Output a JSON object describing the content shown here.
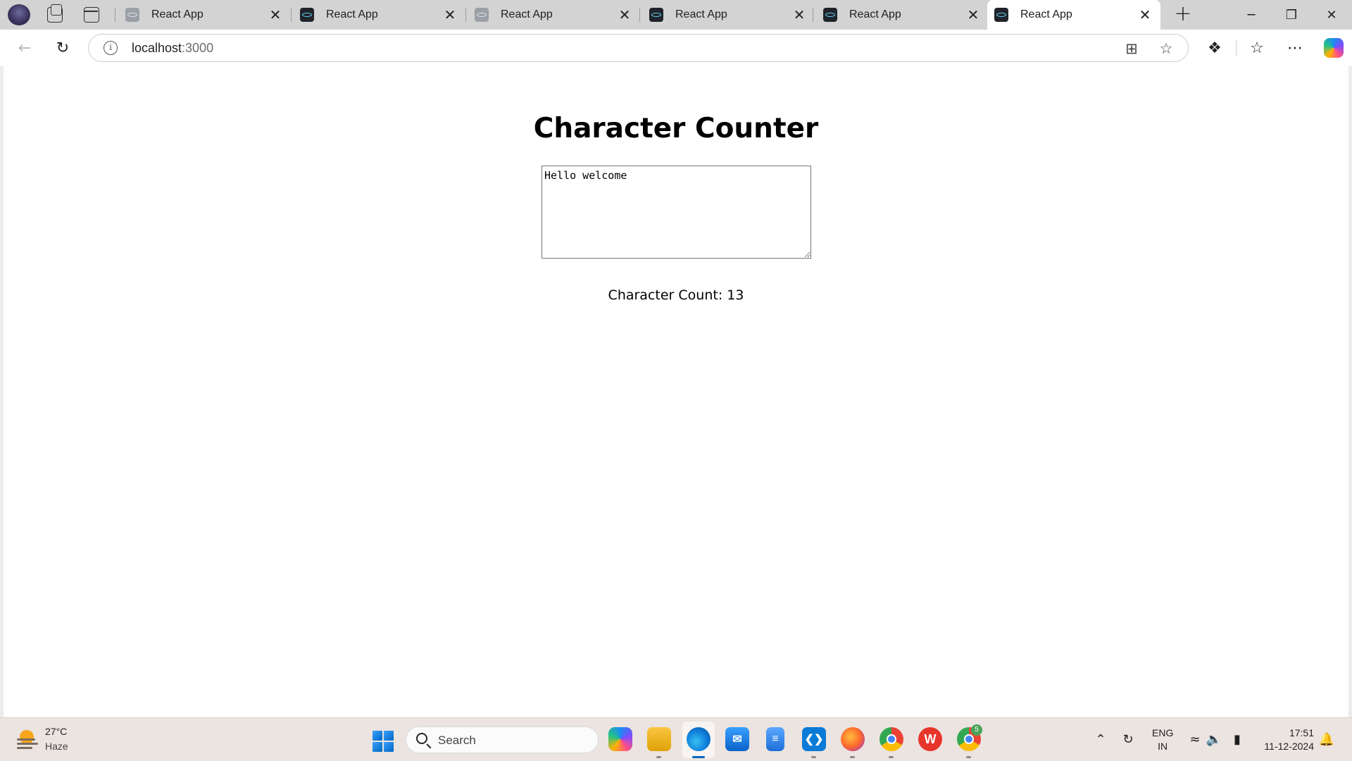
{
  "browser": {
    "tabs": [
      {
        "title": "React App",
        "close": "✕"
      },
      {
        "title": "React App",
        "close": "✕"
      },
      {
        "title": "React App",
        "close": "✕"
      },
      {
        "title": "React App",
        "close": "✕"
      },
      {
        "title": "React App",
        "close": "✕"
      },
      {
        "title": "React App",
        "close": "✕"
      }
    ],
    "active_tab_index": 5,
    "new_tab": "+",
    "window_controls": {
      "minimize": "─",
      "restore": "❐",
      "close": "✕"
    },
    "url_host": "localhost",
    "url_port": ":3000"
  },
  "page": {
    "title": "Character Counter",
    "textarea_value": "Hello welcome",
    "count_label": "Character Count: 13"
  },
  "taskbar": {
    "weather_temp": "27°C",
    "weather_desc": "Haze",
    "search_label": "Search",
    "lang_line1": "ENG",
    "lang_line2": "IN",
    "time": "17:51",
    "date": "11-12-2024",
    "chrome_badge": "5"
  },
  "colors": {
    "accent": "#0067c0",
    "react": "#61dafb",
    "tabstrip": "#d3d3d3",
    "taskbar": "#ebe4e0"
  }
}
